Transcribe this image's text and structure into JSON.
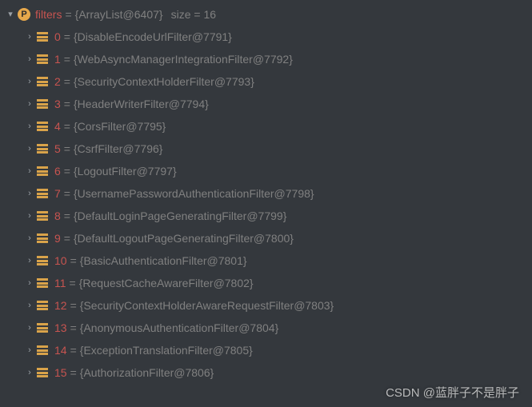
{
  "root": {
    "badge": "P",
    "name": "filters",
    "value": "{ArrayList@6407}",
    "sizeLabel": "size",
    "size": "16"
  },
  "items": [
    {
      "index": "0",
      "value": "{DisableEncodeUrlFilter@7791}"
    },
    {
      "index": "1",
      "value": "{WebAsyncManagerIntegrationFilter@7792}"
    },
    {
      "index": "2",
      "value": "{SecurityContextHolderFilter@7793}"
    },
    {
      "index": "3",
      "value": "{HeaderWriterFilter@7794}"
    },
    {
      "index": "4",
      "value": "{CorsFilter@7795}"
    },
    {
      "index": "5",
      "value": "{CsrfFilter@7796}"
    },
    {
      "index": "6",
      "value": "{LogoutFilter@7797}"
    },
    {
      "index": "7",
      "value": "{UsernamePasswordAuthenticationFilter@7798}"
    },
    {
      "index": "8",
      "value": "{DefaultLoginPageGeneratingFilter@7799}"
    },
    {
      "index": "9",
      "value": "{DefaultLogoutPageGeneratingFilter@7800}"
    },
    {
      "index": "10",
      "value": "{BasicAuthenticationFilter@7801}"
    },
    {
      "index": "11",
      "value": "{RequestCacheAwareFilter@7802}"
    },
    {
      "index": "12",
      "value": "{SecurityContextHolderAwareRequestFilter@7803}"
    },
    {
      "index": "13",
      "value": "{AnonymousAuthenticationFilter@7804}"
    },
    {
      "index": "14",
      "value": "{ExceptionTranslationFilter@7805}"
    },
    {
      "index": "15",
      "value": "{AuthorizationFilter@7806}"
    }
  ],
  "watermark": "CSDN @蓝胖子不是胖子"
}
